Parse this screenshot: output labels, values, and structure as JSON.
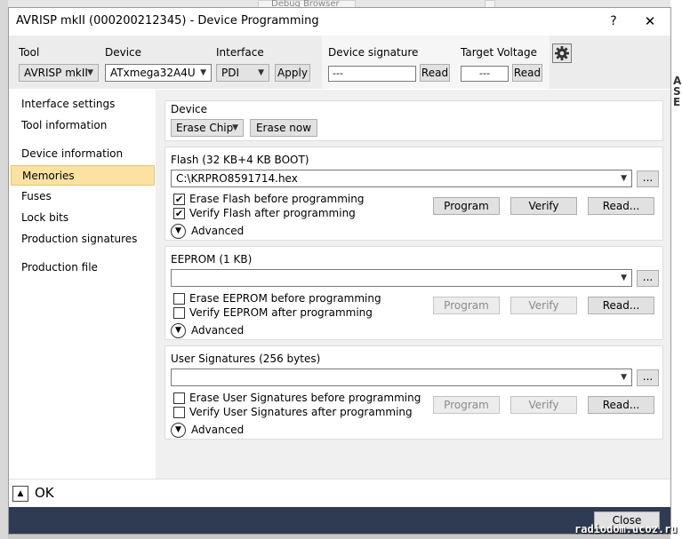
{
  "window": {
    "title": "AVRISP mkII (000200212345) - Device Programming",
    "help_label": "?",
    "close_label": "✕"
  },
  "background": {
    "tab_label": "Debug Browser"
  },
  "toolbar": {
    "tool_label": "Tool",
    "tool_value": "AVRISP mkII",
    "device_label": "Device",
    "device_value": "ATxmega32A4U",
    "interface_label": "Interface",
    "interface_value": "PDI",
    "apply_label": "Apply",
    "signature_label": "Device signature",
    "signature_value": "---",
    "signature_read": "Read",
    "voltage_label": "Target Voltage",
    "voltage_value": "---",
    "voltage_read": "Read"
  },
  "sidebar": {
    "items": [
      {
        "label": "Interface settings"
      },
      {
        "label": "Tool information"
      },
      {
        "label": "Device information"
      },
      {
        "label": "Memories"
      },
      {
        "label": "Fuses"
      },
      {
        "label": "Lock bits"
      },
      {
        "label": "Production signatures"
      },
      {
        "label": "Production file"
      }
    ],
    "active": "Memories"
  },
  "device_section": {
    "title": "Device",
    "erase_mode": "Erase Chip",
    "erase_now": "Erase now"
  },
  "flash": {
    "title": "Flash (32 KB+4 KB BOOT)",
    "file": "C:\\KRPRO8591714.hex",
    "browse": "...",
    "erase_check": "Erase Flash before programming",
    "erase_checked": true,
    "verify_check": "Verify Flash after programming",
    "verify_checked": true,
    "advanced": "Advanced",
    "program": "Program",
    "verify": "Verify",
    "read": "Read..."
  },
  "eeprom": {
    "title": "EEPROM (1 KB)",
    "file": "",
    "browse": "...",
    "erase_check": "Erase EEPROM before programming",
    "verify_check": "Verify EEPROM after programming",
    "advanced": "Advanced",
    "program": "Program",
    "verify": "Verify",
    "read": "Read..."
  },
  "usersig": {
    "title": "User Signatures (256 bytes)",
    "file": "",
    "browse": "...",
    "erase_check": "Erase User Signatures before programming",
    "verify_check": "Verify User Signatures after programming",
    "advanced": "Advanced",
    "program": "Program",
    "verify": "Verify",
    "read": "Read..."
  },
  "status": {
    "label": "OK",
    "toggle": "▲"
  },
  "footer": {
    "close": "Close"
  },
  "watermark": "radiodom.ucoz.ru"
}
